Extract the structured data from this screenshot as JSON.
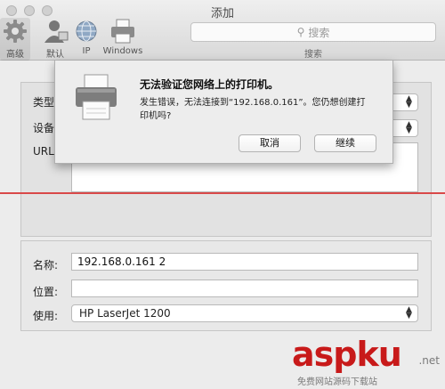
{
  "window": {
    "title": "添加"
  },
  "toolbar": {
    "items": [
      {
        "label": "高级",
        "icon": "gear-icon"
      },
      {
        "label": "默认",
        "icon": "user-icon"
      },
      {
        "label": "IP",
        "icon": "globe-icon"
      },
      {
        "label": "Windows",
        "icon": "printer-icon"
      }
    ],
    "search": {
      "placeholder": "搜索",
      "caption": "搜索"
    }
  },
  "form_top": {
    "type_label": "类型",
    "device_label": "设备",
    "url_label": "URL"
  },
  "form_bottom": {
    "name_label": "名称:",
    "name_value": "192.168.0.161 2",
    "location_label": "位置:",
    "location_value": "",
    "use_label": "使用:",
    "use_value": "HP LaserJet 1200"
  },
  "alert": {
    "title": "无法验证您网络上的打印机。",
    "message": "发生错误，无法连接到“192.168.0.161”。您仍想创建打印机吗?",
    "cancel_label": "取消",
    "continue_label": "继续"
  },
  "watermark": {
    "brand": "aspku",
    "net": ".net",
    "subtitle": "免费网站源码下载站"
  },
  "colors": {
    "accent_line": "#d94949",
    "watermark": "#c81a1a"
  }
}
